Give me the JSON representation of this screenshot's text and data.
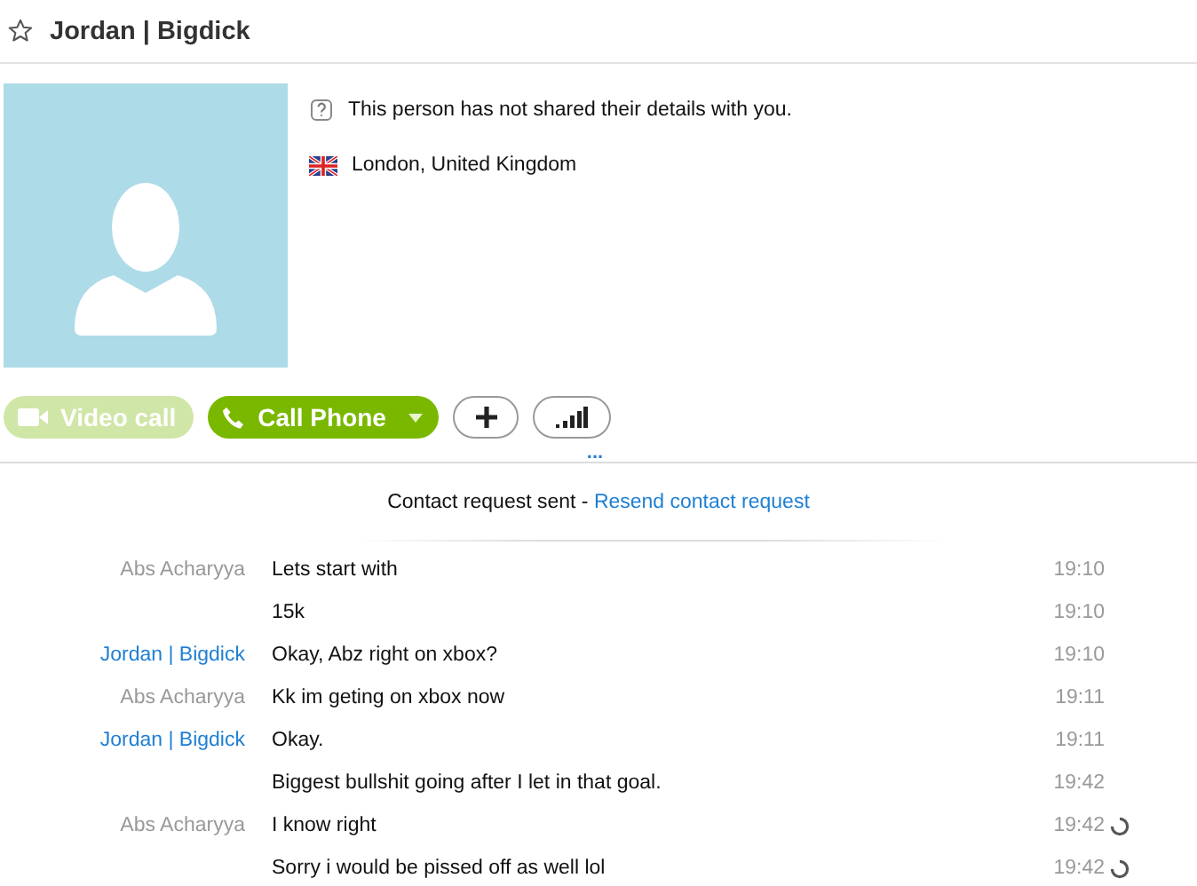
{
  "header": {
    "title": "Jordan | Bigdick",
    "favorite": false
  },
  "profile": {
    "notice": "This person has not shared their details with you.",
    "location": "London, United Kingdom"
  },
  "actions": {
    "video_call": {
      "label": "Video call",
      "disabled": true
    },
    "call_phone": {
      "label": "Call Phone"
    }
  },
  "more": "...",
  "contact_request": {
    "text": "Contact request sent - ",
    "link": "Resend contact request"
  },
  "messages": [
    {
      "sender": "Abs Acharyya",
      "kind": "other",
      "text": "Lets start with",
      "time": "19:10",
      "pending": false
    },
    {
      "kind": "continued",
      "text": "15k",
      "time": "19:10",
      "pending": false
    },
    {
      "sender": "Jordan | Bigdick",
      "kind": "contact",
      "text": "Okay, Abz right on xbox?",
      "time": "19:10",
      "pending": false
    },
    {
      "sender": "Abs Acharyya",
      "kind": "other",
      "text": "Kk im geting on xbox now",
      "time": "19:11",
      "pending": false
    },
    {
      "sender": "Jordan | Bigdick",
      "kind": "contact",
      "text": "Okay.",
      "time": "19:11",
      "pending": false
    },
    {
      "kind": "continued",
      "text": "Biggest bullshit going after I let in that goal.",
      "time": "19:42",
      "pending": false
    },
    {
      "sender": "Abs Acharyya",
      "kind": "other",
      "text": "I know right",
      "time": "19:42",
      "pending": true
    },
    {
      "kind": "continued",
      "text": "Sorry i would be pissed off as well lol",
      "time": "19:42",
      "pending": true
    }
  ]
}
